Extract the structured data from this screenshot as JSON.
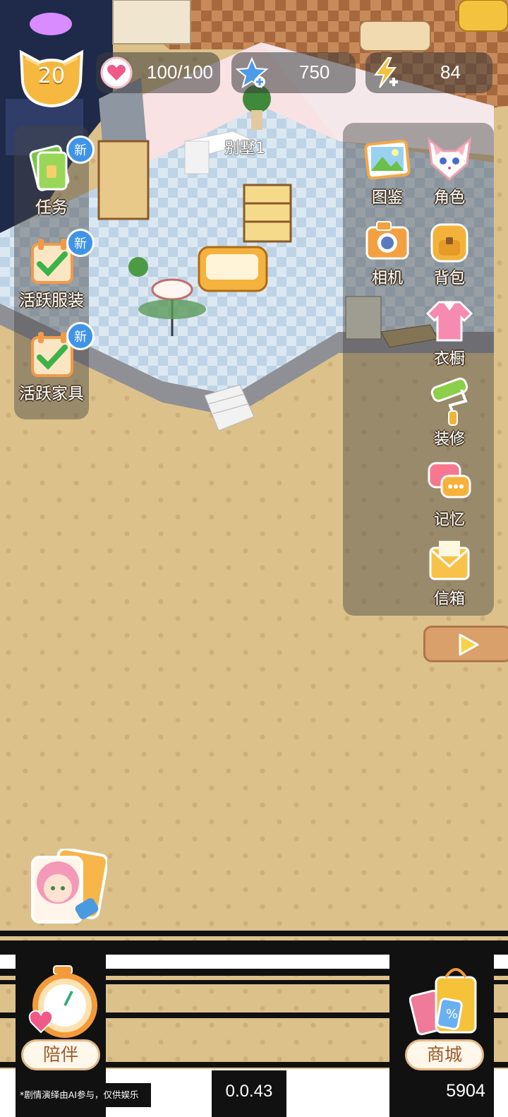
{
  "header": {
    "level": "20",
    "hearts": "100/100",
    "stars": "750",
    "energy": "84"
  },
  "room": {
    "name": "别墅1"
  },
  "left_menu": [
    {
      "label": "任务",
      "badge": "新",
      "icon": "task-book-icon"
    },
    {
      "label": "活跃服装",
      "badge": "新",
      "icon": "calendar-check-icon"
    },
    {
      "label": "活跃家具",
      "badge": "新",
      "icon": "calendar-check-icon"
    }
  ],
  "right_menu": [
    {
      "label": "图鉴",
      "icon": "picture-icon"
    },
    {
      "label": "角色",
      "icon": "fox-character-icon"
    },
    {
      "label": "相机",
      "icon": "camera-icon"
    },
    {
      "label": "背包",
      "icon": "backpack-icon"
    },
    {
      "label": "衣橱",
      "icon": "shirt-icon"
    },
    {
      "label": "装修",
      "icon": "paint-roller-icon"
    },
    {
      "label": "记忆",
      "icon": "chat-bubble-icon"
    },
    {
      "label": "信箱",
      "icon": "mail-envelope-icon"
    }
  ],
  "bottom": {
    "companion_label": "陪伴",
    "shop_label": "商城",
    "disclaimer": "*剧情演绎由AI参与，仅供娱乐",
    "version": "0.0.43",
    "score": "5904"
  },
  "colors": {
    "floor_tan": "#dcc18b",
    "panel_overlay": "rgba(70,70,70,0.45)",
    "badge_blue": "#3e94e8",
    "heart_pink": "#f05a87",
    "star_blue": "#4c9be8",
    "energy_yellow": "#f3c13a"
  }
}
